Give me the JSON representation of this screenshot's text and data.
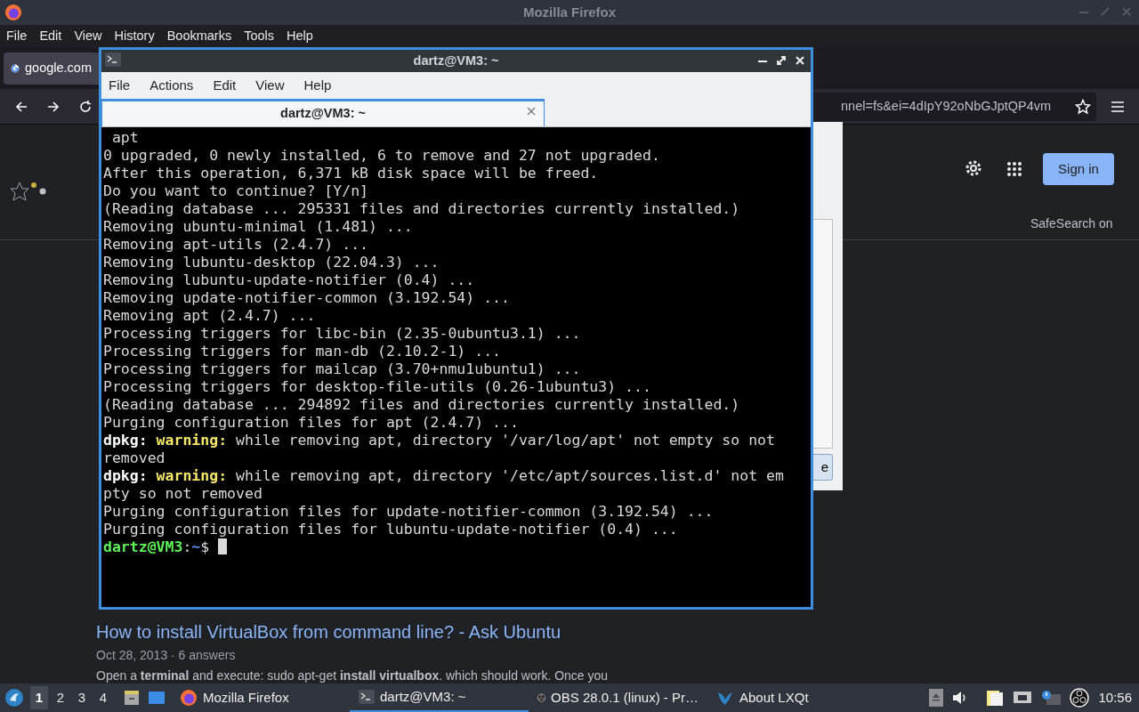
{
  "firefox": {
    "title": "Mozilla Firefox",
    "menu": [
      "File",
      "Edit",
      "View",
      "History",
      "Bookmarks",
      "Tools",
      "Help"
    ],
    "tab": {
      "title": "google.com"
    },
    "url": "nnel=fs&ei=4dIpY92oNbGJptQP4vm"
  },
  "google": {
    "sign_in": "Sign in",
    "safesearch": "SafeSearch on",
    "result": {
      "title": "How to install VirtualBox from command line? - Ask Ubuntu",
      "meta": "Oct 28, 2013 · 6 answers",
      "snippet": "Open a **terminal** and execute: sudo apt-get **install virtualbox**. which should work. Once you"
    }
  },
  "dialog": {
    "button": "e"
  },
  "terminal": {
    "title": "dartz@VM3: ~",
    "menu": [
      "File",
      "Actions",
      "Edit",
      "View",
      "Help"
    ],
    "tabs": [
      {
        "title": "dartz@VM3: ~",
        "selected": true
      }
    ],
    "lines": [
      [
        {
          "text": " apt"
        }
      ],
      [
        {
          "text": "0 upgraded, 0 newly installed, 6 to remove and 27 not upgraded."
        }
      ],
      [
        {
          "text": "After this operation, 6,371 kB disk space will be freed."
        }
      ],
      [
        {
          "text": "Do you want to continue? [Y/n]"
        }
      ],
      [
        {
          "text": "(Reading database ... 295331 files and directories currently installed.)"
        }
      ],
      [
        {
          "text": "Removing ubuntu-minimal (1.481) ..."
        }
      ],
      [
        {
          "text": "Removing apt-utils (2.4.7) ..."
        }
      ],
      [
        {
          "text": "Removing lubuntu-desktop (22.04.3) ..."
        }
      ],
      [
        {
          "text": "Removing lubuntu-update-notifier (0.4) ..."
        }
      ],
      [
        {
          "text": "Removing update-notifier-common (3.192.54) ..."
        }
      ],
      [
        {
          "text": "Removing apt (2.4.7) ..."
        }
      ],
      [
        {
          "text": "Processing triggers for libc-bin (2.35-0ubuntu3.1) ..."
        }
      ],
      [
        {
          "text": "Processing triggers for man-db (2.10.2-1) ..."
        }
      ],
      [
        {
          "text": "Processing triggers for mailcap (3.70+nmu1ubuntu1) ..."
        }
      ],
      [
        {
          "text": "Processing triggers for desktop-file-utils (0.26-1ubuntu3) ..."
        }
      ],
      [
        {
          "text": "(Reading database ... 294892 files and directories currently installed.)"
        }
      ],
      [
        {
          "text": "Purging configuration files for apt (2.4.7) ..."
        }
      ],
      [
        {
          "text": "dpkg:",
          "kind": "bold"
        },
        {
          "text": " warning:",
          "kind": "warn"
        },
        {
          "text": " while removing apt, directory '/var/log/apt' not empty so not"
        }
      ],
      [
        {
          "text": "removed"
        }
      ],
      [
        {
          "text": "dpkg:",
          "kind": "bold"
        },
        {
          "text": " warning:",
          "kind": "warn"
        },
        {
          "text": " while removing apt, directory '/etc/apt/sources.list.d' not em"
        }
      ],
      [
        {
          "text": "pty so not removed"
        }
      ],
      [
        {
          "text": "Purging configuration files for update-notifier-common (3.192.54) ..."
        }
      ],
      [
        {
          "text": "Purging configuration files for lubuntu-update-notifier (0.4) ..."
        }
      ],
      [
        {
          "text": "dartz@VM3",
          "kind": "user"
        },
        {
          "text": ":"
        },
        {
          "text": "~",
          "kind": "path"
        },
        {
          "text": "$ "
        }
      ]
    ]
  },
  "taskbar": {
    "desktops": [
      {
        "label": "1",
        "selected": true
      },
      {
        "label": "2",
        "selected": false
      },
      {
        "label": "3",
        "selected": false
      },
      {
        "label": "4",
        "selected": false
      }
    ],
    "tasks": [
      {
        "kind": "firefox",
        "label": "Mozilla Firefox",
        "selected": false
      },
      {
        "kind": "terminal",
        "label": "dartz@VM3: ~",
        "selected": true
      },
      {
        "kind": "obs",
        "label": "OBS 28.0.1 (linux) - Pr…",
        "selected": false
      },
      {
        "kind": "lxqt",
        "label": "About LXQt",
        "selected": false
      }
    ],
    "clock": "10:56"
  }
}
